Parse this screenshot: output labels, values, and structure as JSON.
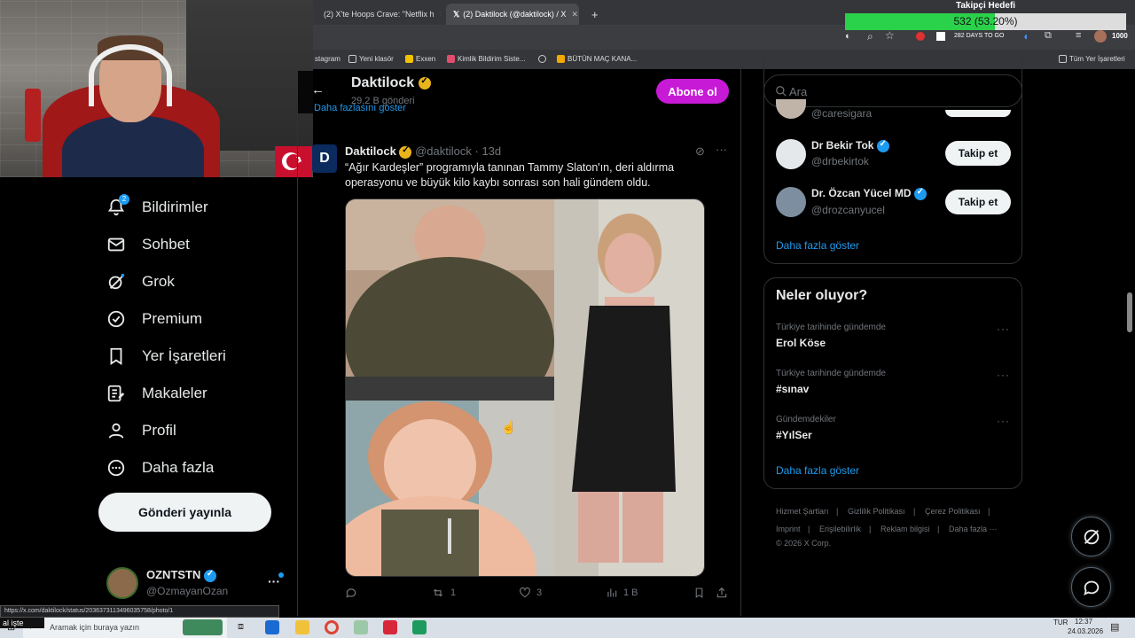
{
  "overlay": {
    "takipci_label": "Takipçi Hedefi",
    "progress_text": "532 (53.20%)",
    "progress_fraction": 0.532,
    "progress_color": "#2ad14a"
  },
  "browser": {
    "tabs": [
      {
        "label": "(2) X'te Hoops Crave: \"Netflix h",
        "active": false
      },
      {
        "label": "(2) Daktilock (@daktilock) / X",
        "active": true
      }
    ],
    "new_tab": "+",
    "extension_counter": "1000",
    "countdown_ext": "282 DAYS TO GO",
    "bookmarks": [
      {
        "label": "stagram",
        "icon": "instagram-icon"
      },
      {
        "label": "Yeni klasör",
        "icon": "folder-icon"
      },
      {
        "label": "Exxen",
        "icon": "exxen-icon"
      },
      {
        "label": "Kimlik Bildirim Siste...",
        "icon": "pen-icon"
      },
      {
        "label": "",
        "icon": "globe-icon"
      },
      {
        "label": "BÜTÜN MAÇ KANA...",
        "icon": "jp-icon"
      },
      {
        "label": "Tüm Yer İşaretleri",
        "icon": "folder-icon"
      }
    ]
  },
  "sidebar": {
    "notifications_badge": "2",
    "items": [
      {
        "label": "Bildirimler",
        "icon": "bell-icon"
      },
      {
        "label": "Sohbet",
        "icon": "envelope-icon"
      },
      {
        "label": "Grok",
        "icon": "grok-icon"
      },
      {
        "label": "Premium",
        "icon": "premium-check-icon"
      },
      {
        "label": "Yer İşaretleri",
        "icon": "bookmark-icon"
      },
      {
        "label": "Makaleler",
        "icon": "article-icon"
      },
      {
        "label": "Profil",
        "icon": "person-icon"
      },
      {
        "label": "Daha fazla",
        "icon": "more-circle-icon"
      }
    ],
    "post_button": "Gönderi yayınla",
    "profile": {
      "name": "OZNTSTN",
      "handle": "@OzmayanOzan",
      "more": "···"
    }
  },
  "header": {
    "title": "Daktilock",
    "subtitle": "29,2 B gönderi",
    "subscribe": "Abone ol",
    "partial_link": "Daha fazlasını göster"
  },
  "tweet": {
    "author": "Daktilock",
    "handle": "@daktilock",
    "sep": "·",
    "time": "13d",
    "text_line1": "“Ağır Kardeşler” programıyla tanınan Tammy Slaton'ın, deri aldırma",
    "text_line2": "operasyonu ve büyük kilo kaybı sonrası son hali gündem oldu.",
    "actions": {
      "reply": "",
      "retweet": "1",
      "like": "3",
      "views": "1 B"
    }
  },
  "right": {
    "search_placeholder": "Ara",
    "partial_handle": "@caresigara",
    "who_to_follow": [
      {
        "name": "Dr Bekir Tok",
        "handle": "@drbekirtok",
        "button": "Takip et"
      },
      {
        "name": "Dr. Özcan Yücel MD",
        "handle": "@drozcanyucel",
        "button": "Takip et"
      }
    ],
    "show_more_1": "Daha fazla göster",
    "trends_title": "Neler oluyor?",
    "trends": [
      {
        "category": "Türkiye tarihinde gündemde",
        "name": "Erol Köse"
      },
      {
        "category": "Türkiye tarihinde gündemde",
        "name": "#sınav"
      },
      {
        "category": "Gündemdekiler",
        "name": "#YılSer"
      }
    ],
    "show_more_2": "Daha fazla göster",
    "footer": {
      "l1": "Hizmet Şartları",
      "l2": "Gizlilik Politikası",
      "l3": "Çerez Politikası",
      "l4": "Imprint",
      "l5": "Erişilebilirlik",
      "l6": "Reklam bilgisi",
      "l7": "Daha fazla ···",
      "copyright": "© 2026 X Corp.",
      "sep": "|"
    }
  },
  "status_bar": {
    "url": "https://x.com/daktilock/status/2036373113496035758/photo/1"
  },
  "taskbar": {
    "search_placeholder": "Aramak için buraya yazın",
    "left_overlay": "al işte",
    "lang": "TUR",
    "time": "12:37",
    "date": "24.03.2026"
  },
  "colors": {
    "accent": "#1d9bf0",
    "subscribe": "#c71ad6",
    "gold_badge": "#e8b41b"
  }
}
